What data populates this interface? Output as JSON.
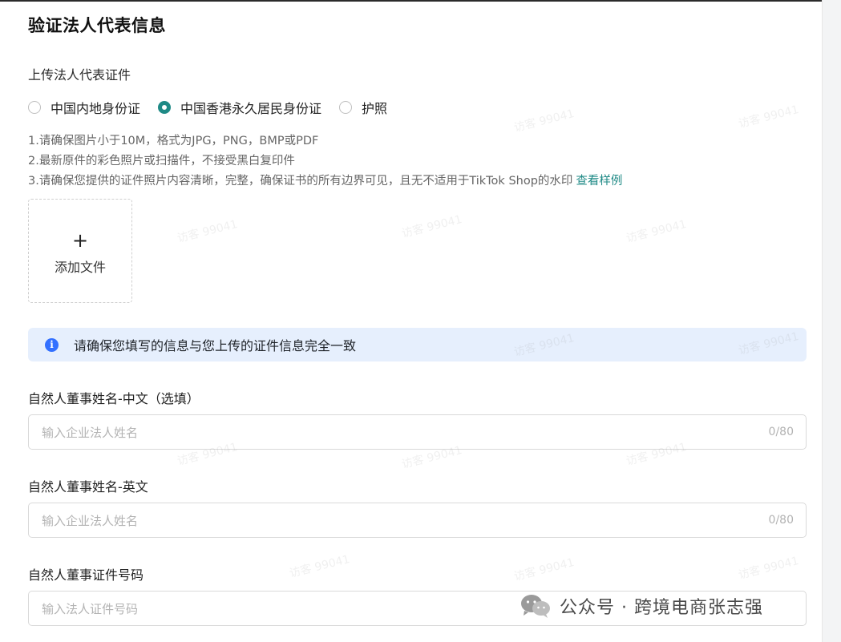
{
  "page": {
    "title": "验证法人代表信息",
    "upload_section_label": "上传法人代表证件"
  },
  "id_types": [
    {
      "label": "中国内地身份证",
      "checked": false
    },
    {
      "label": "中国香港永久居民身份证",
      "checked": true
    },
    {
      "label": "护照",
      "checked": false
    }
  ],
  "hints": {
    "line1": "1.请确保图片小于10M，格式为JPG，PNG，BMP或PDF",
    "line2": "2.最新原件的彩色照片或扫描件，不接受黑白复印件",
    "line3": "3.请确保您提供的证件照片内容清晰，完整，确保证书的所有边界可见，且无不适用于TikTok Shop的水印",
    "example_link": "查看样例"
  },
  "upload": {
    "plus": "+",
    "label": "添加文件"
  },
  "notice": {
    "icon": "info-icon",
    "text": "请确保您填写的信息与您上传的证件信息完全一致"
  },
  "fields": {
    "name_cn": {
      "label": "自然人董事姓名-中文（选填）",
      "placeholder": "输入企业法人姓名",
      "count": "0/80"
    },
    "name_en": {
      "label": "自然人董事姓名-英文",
      "placeholder": "输入企业法人姓名",
      "count": "0/80"
    },
    "id_number": {
      "label": "自然人董事证件号码",
      "placeholder": "输入法人证件号码"
    }
  },
  "watermark": {
    "text": "访客 99041",
    "footer": "公众号 · 跨境电商张志强"
  },
  "colors": {
    "accent": "#1f8a86",
    "notice_bg": "#e6effd",
    "info_blue": "#3370ff"
  }
}
